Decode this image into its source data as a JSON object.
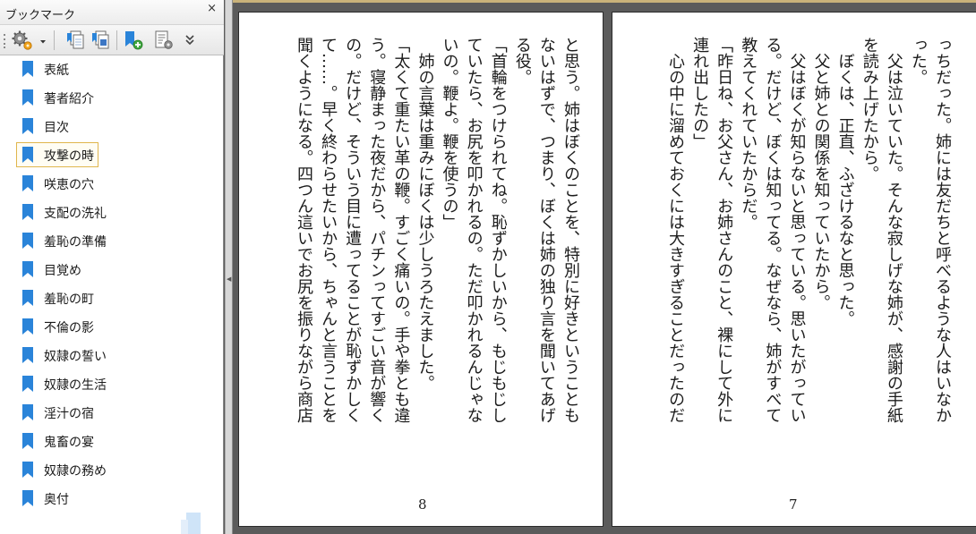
{
  "panel": {
    "title": "ブックマーク",
    "close": "×",
    "toolbar": [
      {
        "name": "options-gear-icon"
      },
      {
        "name": "dropdown-arrow-icon"
      },
      {
        "name": "expand-bookmark-icon"
      },
      {
        "name": "collapse-bookmark-icon"
      },
      {
        "name": "new-bookmark-icon"
      },
      {
        "name": "bookmark-properties-icon"
      },
      {
        "name": "more-chevron-icon"
      }
    ]
  },
  "bookmarks": [
    {
      "label": "表紙"
    },
    {
      "label": "著者紹介"
    },
    {
      "label": "目次"
    },
    {
      "label": "攻撃の時",
      "selected": true
    },
    {
      "label": "咲恵の穴"
    },
    {
      "label": "支配の洗礼"
    },
    {
      "label": "羞恥の準備"
    },
    {
      "label": "目覚め"
    },
    {
      "label": "羞恥の町"
    },
    {
      "label": "不倫の影"
    },
    {
      "label": "奴隷の誓い"
    },
    {
      "label": "奴隷の生活"
    },
    {
      "label": "淫汁の宿"
    },
    {
      "label": "鬼畜の宴"
    },
    {
      "label": "奴隷の務め"
    },
    {
      "label": "奥付"
    }
  ],
  "colors": {
    "bookmark_icon": "#2a84d9",
    "selected_border": "#e0b64d",
    "viewer_bg": "#5b5b5b"
  },
  "pages": {
    "left": {
      "number": "8",
      "lines": [
        "と思う。姉はぼくのことを、特別に好きということも",
        "ないはずで、つまり、ぼくは姉の独り言を聞いてあげ",
        "る役。",
        "「首輪をつけられてね。恥ずかしいから、もじもじし",
        "ていたら、お尻を叩かれるの。ただ叩かれるんじゃな",
        "いの。鞭よ。鞭を使うの」",
        "　姉の言葉は重みにぼくは少しうろたえました。",
        "「太くて重たい革の鞭。すごく痛いの。手や拳とも違",
        "う。寝静まった夜だから、パチンってすごい音が響く",
        "の。だけど、そういう目に遭ってることが恥ずかしく",
        "て……。早く終わらせたいから、ちゃんと言うことを",
        "聞くようになる。四つん這いでお尻を振りながら商店"
      ]
    },
    "right": {
      "number": "7",
      "lines": [
        "っちだった。姉には友だちと呼べるような人はいなか",
        "った。",
        "　父は泣いていた。そんな寂しげな姉が、感謝の手紙",
        "を読み上げたから。",
        "　ぼくは、正直、ふざけるなと思った。",
        "　父と姉との関係を知っていたから。",
        "　父はぼくが知らないと思っている。思いたがってい",
        "る。だけど、ぼくは知ってる。なぜなら、姉がすべて",
        "教えてくれていたからだ。",
        "「昨日ね、お父さん、お姉さんのこと、裸にして外に",
        "連れ出したの」",
        "　心の中に溜めておくには大きすぎることだったのだ"
      ]
    }
  }
}
